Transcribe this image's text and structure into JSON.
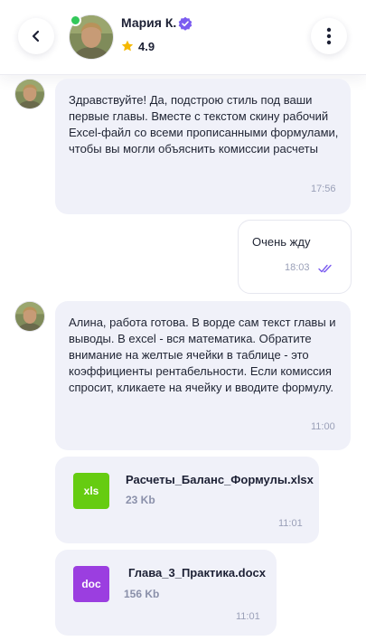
{
  "header": {
    "name": "Мария К.",
    "rating": "4.9"
  },
  "messages": [
    {
      "text": "Здравствуйте! Да, подстрою стиль под ваши первые главы. Вместе с текстом скину рабочий Excel-файл со всеми прописанными формулами, чтобы вы могли объяснить комиссии расчеты",
      "time": "17:56"
    },
    {
      "text": "Очень жду",
      "time": "18:03"
    },
    {
      "text": "Алина, работа готова. В ворде сам текст главы и выводы. В excel - вся математика. Обратите внимание на желтые ячейки в таблице - это коэффициенты рентабельности. Если комиссия спросит, кликаете на ячейку и вводите формулу.",
      "time": "11:00"
    }
  ],
  "files": [
    {
      "ext": "xls",
      "name": "Расчеты_Баланс_Формулы.xlsx",
      "size": "23 Kb",
      "time": "11:01",
      "color": "#66cc11"
    },
    {
      "ext": "doc",
      "name": "Глава_3_Практика.docx",
      "size": "156 Kb",
      "time": "11:01",
      "color": "#9b3ee0"
    }
  ],
  "colors": {
    "accent": "#7b5cf0",
    "online": "#33c85a",
    "star": "#f5b800",
    "incoming_bubble": "#f0f1f9"
  }
}
